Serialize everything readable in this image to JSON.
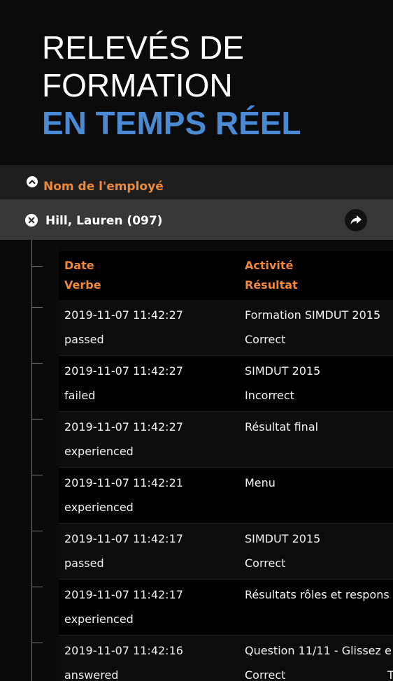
{
  "hero": {
    "line1": "RELEVÉS DE",
    "line2": "FORMATION",
    "line3": "EN TEMPS RÉEL",
    "accent_color": "#4a8ad4"
  },
  "sort": {
    "icon": "chevron-up-circle-icon",
    "label": "Nom de l'employé",
    "label_color": "#f0883a"
  },
  "employee": {
    "close_icon": "close-circle-icon",
    "name": "Hill, Lauren (097)",
    "share_icon": "share-forward-icon"
  },
  "table": {
    "headers": {
      "date": "Date",
      "verb": "Verbe",
      "activity": "Activité",
      "result": "Résultat"
    },
    "rows": [
      {
        "date": "2019-11-07 11:42:27",
        "verb": "passed",
        "activity": "Formation SIMDUT 2015",
        "result": "Correct"
      },
      {
        "date": "2019-11-07 11:42:27",
        "verb": "failed",
        "activity": "SIMDUT 2015",
        "result": "Incorrect"
      },
      {
        "date": "2019-11-07 11:42:27",
        "verb": "experienced",
        "activity": "Résultat final",
        "result": ""
      },
      {
        "date": "2019-11-07 11:42:21",
        "verb": "experienced",
        "activity": "Menu",
        "result": ""
      },
      {
        "date": "2019-11-07 11:42:17",
        "verb": "passed",
        "activity": "SIMDUT 2015",
        "result": "Correct"
      },
      {
        "date": "2019-11-07 11:42:17",
        "verb": "experienced",
        "activity": "Résultats rôles et respons",
        "result": ""
      },
      {
        "date": "2019-11-07 11:42:16",
        "verb": "answered",
        "activity": "Question 11/11 - Glissez e",
        "result": "Correct",
        "extra": "T"
      }
    ]
  }
}
